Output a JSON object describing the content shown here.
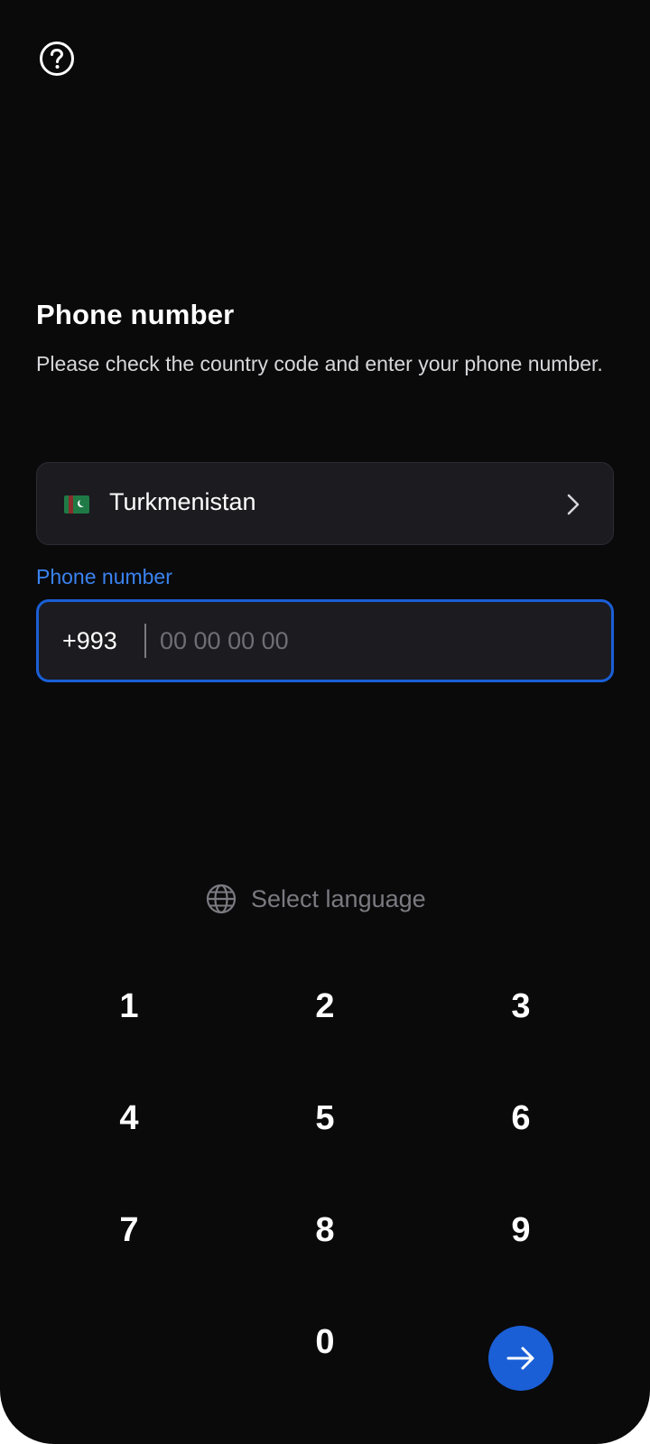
{
  "header": {
    "help_icon": "question-circle-icon"
  },
  "main": {
    "title": "Phone number",
    "subtitle": "Please check the country code and enter your phone number."
  },
  "country": {
    "name": "Turkmenistan",
    "flag_icon": "turkmenistan-flag-icon",
    "chevron_icon": "chevron-right-icon"
  },
  "phone": {
    "label": "Phone number",
    "prefix": "+993",
    "placeholder": "00 00 00 00",
    "value": ""
  },
  "language": {
    "label": "Select language",
    "icon": "globe-icon"
  },
  "keypad": {
    "keys": [
      "1",
      "2",
      "3",
      "4",
      "5",
      "6",
      "7",
      "8",
      "9",
      "0"
    ],
    "submit_icon": "arrow-right-icon"
  },
  "colors": {
    "background": "#0a0a0b",
    "accent": "#1a5fd6",
    "label_blue": "#3a83f0",
    "field_bg": "#1b1b20"
  }
}
